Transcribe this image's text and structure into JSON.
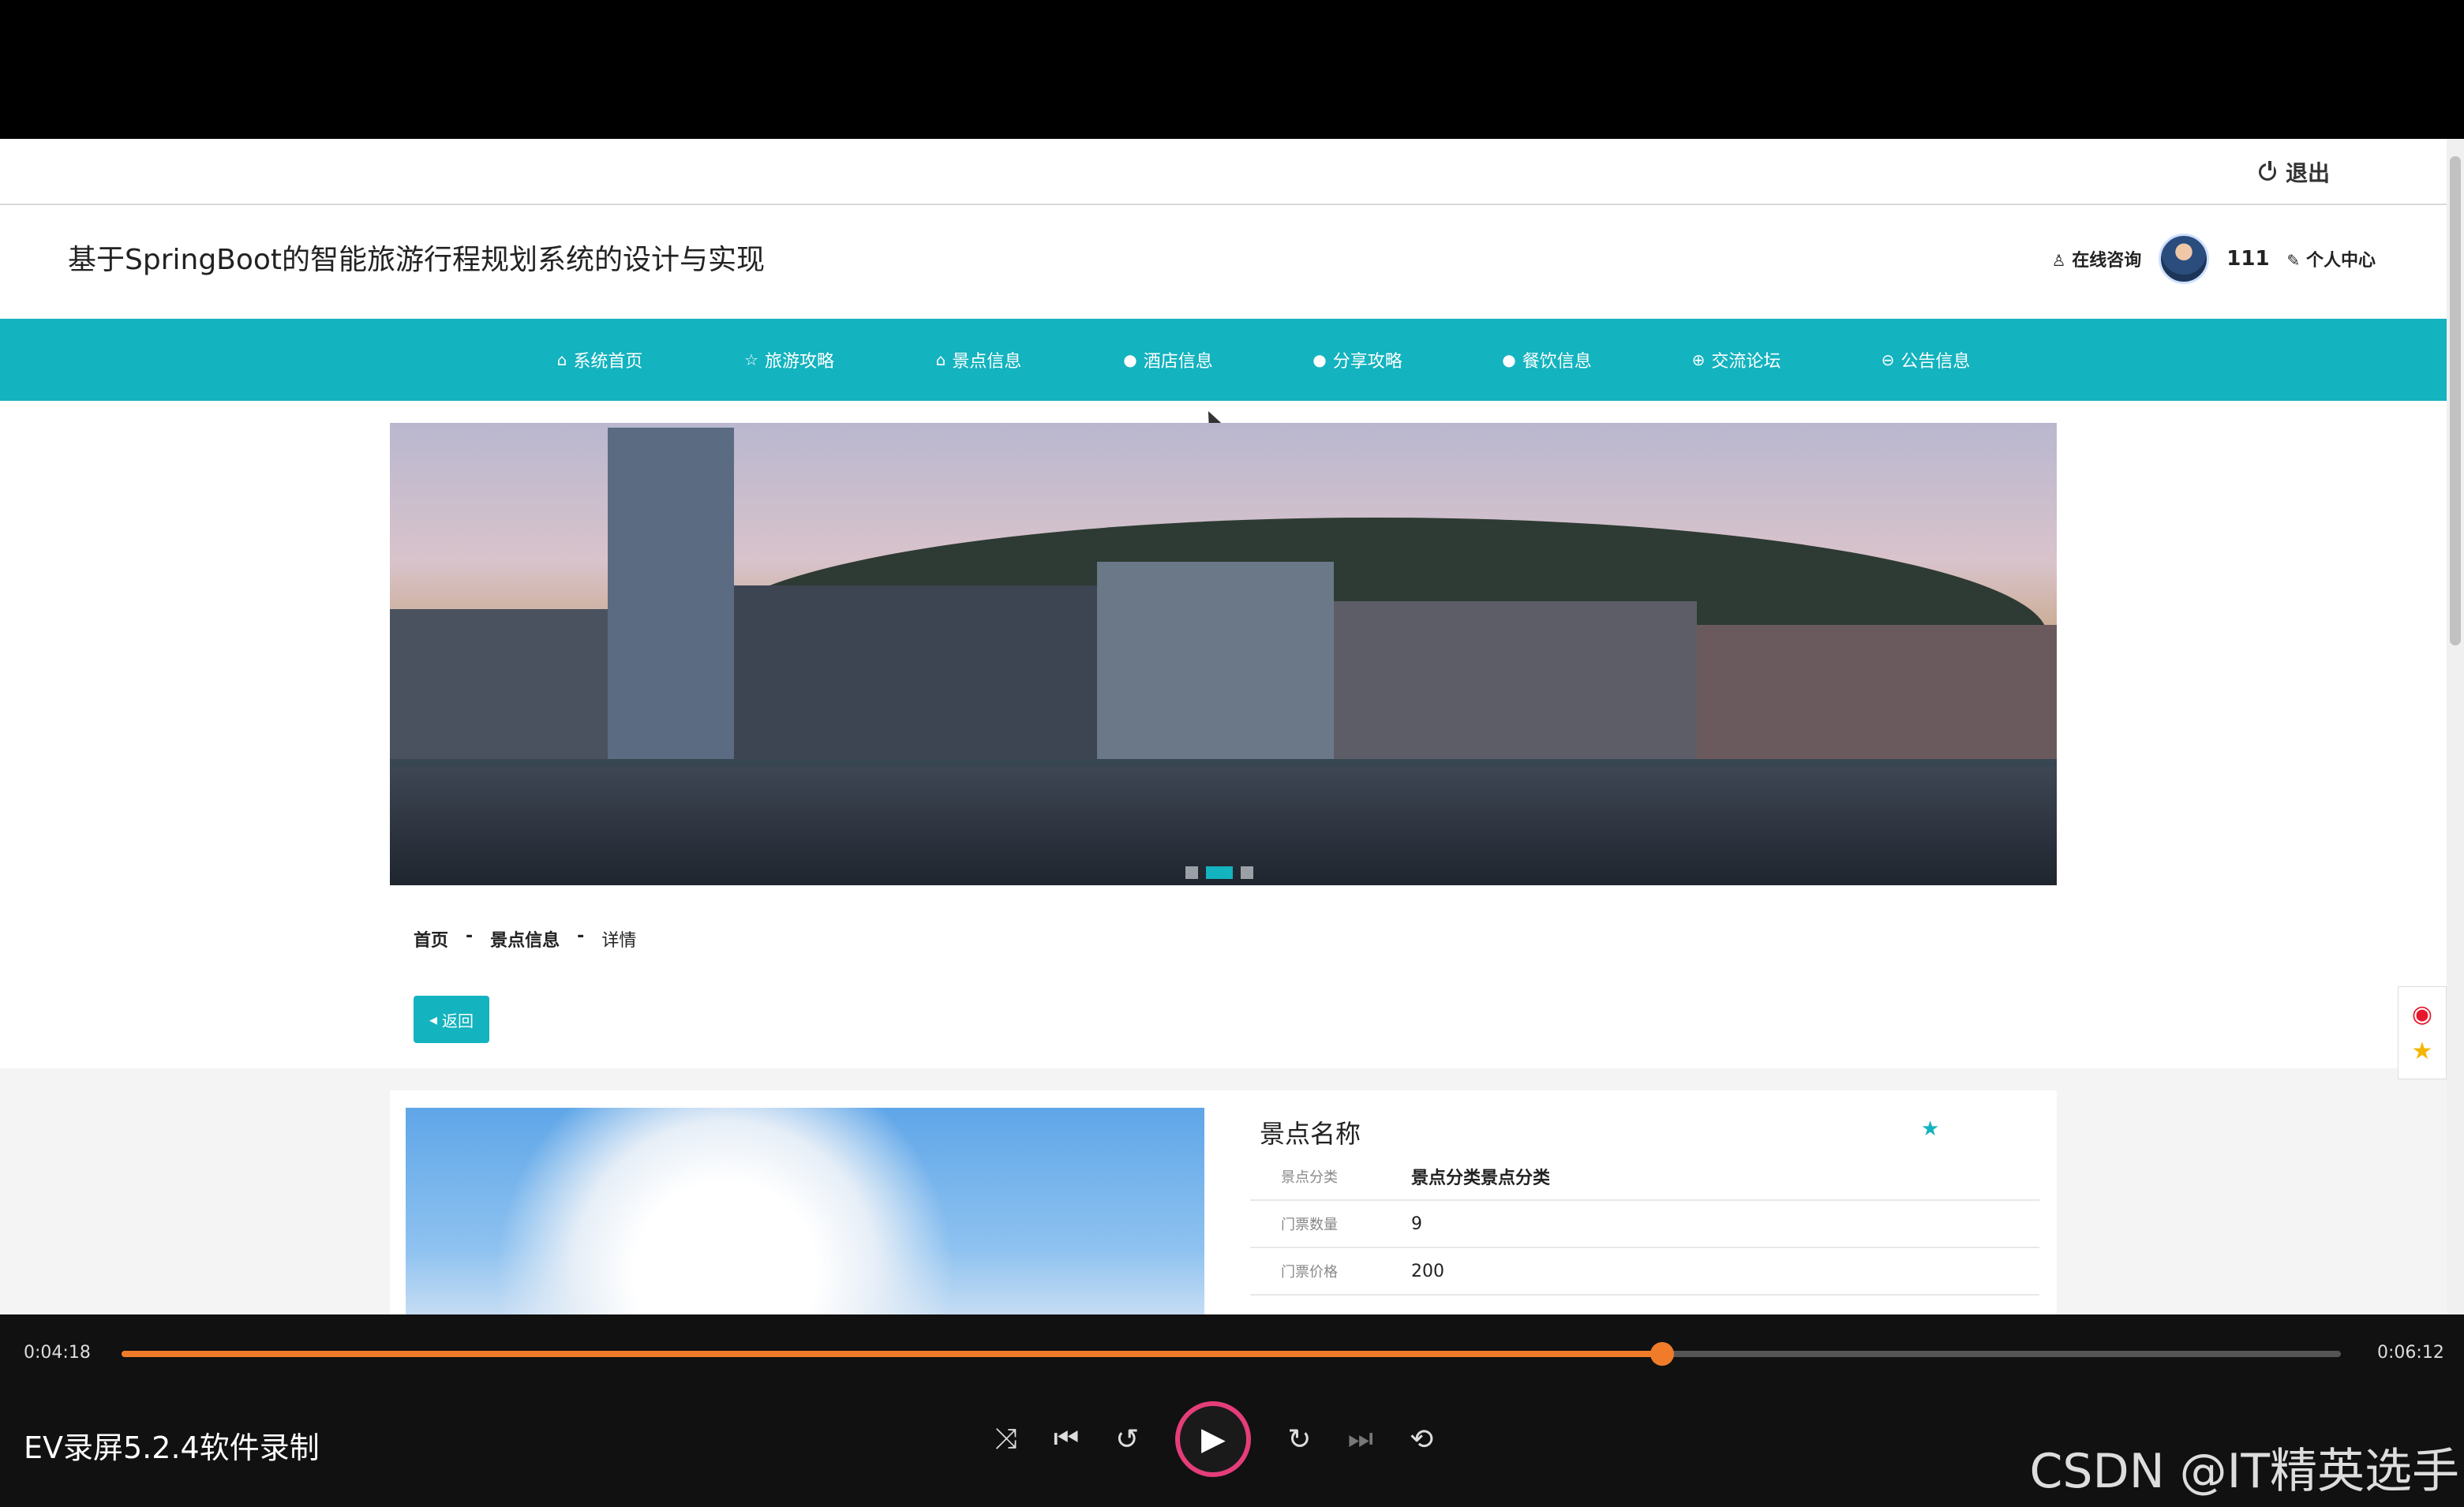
{
  "utility": {
    "logout": "退出"
  },
  "header": {
    "title": "基于SpringBoot的智能旅游行程规划系统的设计与实现",
    "consult": "在线咨询",
    "username": "111",
    "profile": "个人中心"
  },
  "nav": {
    "items": [
      {
        "icon": "⌂",
        "label": "系统首页"
      },
      {
        "icon": "☆",
        "label": "旅游攻略"
      },
      {
        "icon": "⌂",
        "label": "景点信息"
      },
      {
        "icon": "●",
        "label": "酒店信息"
      },
      {
        "icon": "●",
        "label": "分享攻略"
      },
      {
        "icon": "●",
        "label": "餐饮信息"
      },
      {
        "icon": "⊕",
        "label": "交流论坛"
      },
      {
        "icon": "⊖",
        "label": "公告信息"
      }
    ]
  },
  "banner": {
    "slide_count": 3,
    "active_slide": 2
  },
  "breadcrumb": {
    "home": "首页",
    "sep": "-",
    "section": "景点信息",
    "current": "详情"
  },
  "back_button": {
    "label": "返回"
  },
  "detail": {
    "name": "景点名称",
    "rows": [
      {
        "label": "景点分类",
        "value": "景点分类景点分类"
      },
      {
        "label": "门票数量",
        "value": "9"
      },
      {
        "label": "门票价格",
        "value": "200"
      }
    ]
  },
  "player": {
    "current_time": "0:04:18",
    "total_time": "0:06:12",
    "progress": 0.694,
    "title": "EV录屏5.2.4软件录制",
    "watermark": "CSDN @IT精英选手"
  },
  "colors": {
    "accent": "#13b3bf",
    "progress": "#f07c2a"
  }
}
